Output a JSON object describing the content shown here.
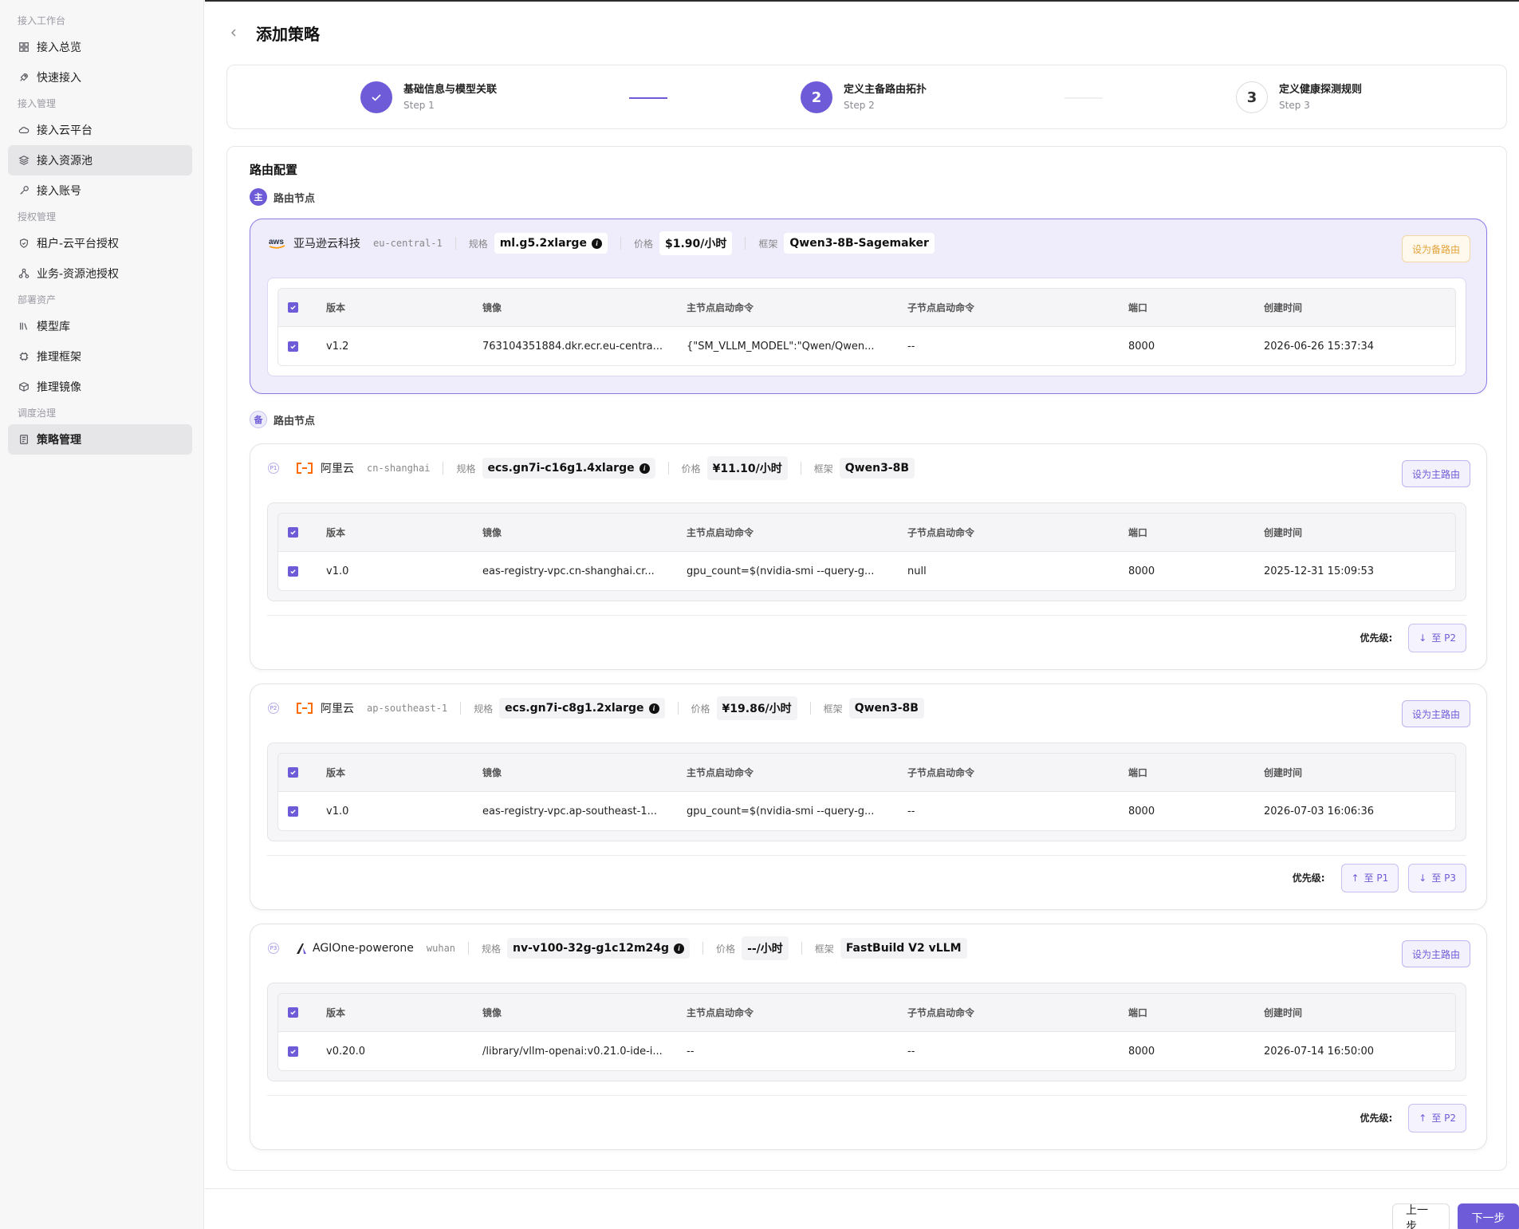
{
  "sidebar": {
    "groups": [
      {
        "title": "接入工作台",
        "items": [
          {
            "label": "接入总览",
            "icon": "grid-icon"
          },
          {
            "label": "快速接入",
            "icon": "rocket-icon"
          }
        ]
      },
      {
        "title": "接入管理",
        "items": [
          {
            "label": "接入云平台",
            "icon": "cloud-icon"
          },
          {
            "label": "接入资源池",
            "icon": "layers-icon"
          },
          {
            "label": "接入账号",
            "icon": "key-icon"
          }
        ]
      },
      {
        "title": "授权管理",
        "items": [
          {
            "label": "租户-云平台授权",
            "icon": "shield-icon"
          },
          {
            "label": "业务-资源池授权",
            "icon": "network-icon"
          }
        ]
      },
      {
        "title": "部署资产",
        "items": [
          {
            "label": "模型库",
            "icon": "library-icon"
          },
          {
            "label": "推理框架",
            "icon": "chip-icon"
          },
          {
            "label": "推理镜像",
            "icon": "box-icon"
          }
        ]
      },
      {
        "title": "调度治理",
        "items": [
          {
            "label": "策略管理",
            "icon": "scroll-icon"
          }
        ]
      }
    ]
  },
  "page": {
    "title": "添加策略"
  },
  "steps": [
    {
      "title": "基础信息与模型关联",
      "sub": "Step 1",
      "state": "done"
    },
    {
      "title": "定义主备路由拓扑",
      "sub": "Step 2",
      "num": "2",
      "state": "active"
    },
    {
      "title": "定义健康探测规则",
      "sub": "Step 3",
      "num": "3",
      "state": "todo"
    }
  ],
  "route": {
    "title": "路由配置",
    "main_label": "路由节点",
    "main_badge": "主",
    "backup_label": "路由节点",
    "backup_badge": "备",
    "labels": {
      "spec": "规格",
      "price": "价格",
      "framework": "框架",
      "priority": "优先级:"
    },
    "columns": [
      "版本",
      "镜像",
      "主节点启动命令",
      "子节点启动命令",
      "端口",
      "创建时间"
    ],
    "primary": {
      "provider": "亚马逊云科技",
      "region": "eu-central-1",
      "spec": "ml.g5.2xlarge",
      "price": "$1.90/小时",
      "framework": "Qwen3-8B-Sagemaker",
      "button": "设为备路由",
      "row": {
        "version": "v1.2",
        "image": "763104351884.dkr.ecr.eu-centra...",
        "main_cmd": "{\"SM_VLLM_MODEL\":\"Qwen/Qwen...",
        "sub_cmd": "--",
        "port": "8000",
        "created": "2026-06-26 15:37:34"
      }
    },
    "backups": [
      {
        "prio": "P1",
        "provider": "阿里云",
        "region": "cn-shanghai",
        "spec": "ecs.gn7i-c16g1.4xlarge",
        "price": "¥11.10/小时",
        "framework": "Qwen3-8B",
        "button": "设为主路由",
        "row": {
          "version": "v1.0",
          "image": "eas-registry-vpc.cn-shanghai.cr...",
          "main_cmd": "gpu_count=$(nvidia-smi --query-g...",
          "sub_cmd": "null",
          "port": "8000",
          "created": "2025-12-31 15:09:53"
        },
        "moves": [
          "至 P2"
        ]
      },
      {
        "prio": "P2",
        "provider": "阿里云",
        "region": "ap-southeast-1",
        "spec": "ecs.gn7i-c8g1.2xlarge",
        "price": "¥19.86/小时",
        "framework": "Qwen3-8B",
        "button": "设为主路由",
        "row": {
          "version": "v1.0",
          "image": "eas-registry-vpc.ap-southeast-1...",
          "main_cmd": "gpu_count=$(nvidia-smi --query-g...",
          "sub_cmd": "--",
          "port": "8000",
          "created": "2026-07-03 16:06:36"
        },
        "moves": [
          "至 P1",
          "至 P3"
        ]
      },
      {
        "prio": "P3",
        "provider": "AGIOne-powerone",
        "region": "wuhan",
        "spec": "nv-v100-32g-g1c12m24g",
        "price": "--/小时",
        "framework": "FastBuild V2 vLLM",
        "button": "设为主路由",
        "row": {
          "version": "v0.20.0",
          "image": "/library/vllm-openai:v0.21.0-ide-i...",
          "main_cmd": "--",
          "sub_cmd": "--",
          "port": "8000",
          "created": "2026-07-14 16:50:00"
        },
        "moves": [
          "至 P2"
        ]
      }
    ]
  },
  "footer": {
    "prev": "上一步",
    "next": "下一步"
  },
  "colors": {
    "accent": "#6e5bd8",
    "aliyun": "#ff6a00",
    "aws_smile": "#ff9900"
  }
}
